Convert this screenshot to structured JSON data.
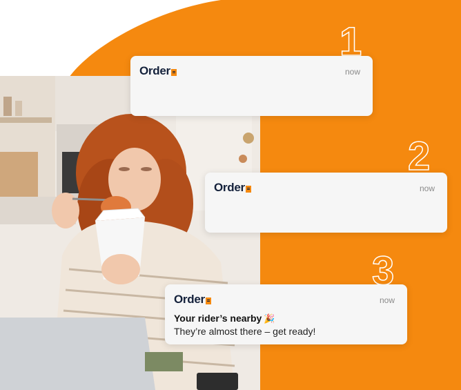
{
  "colors": {
    "accent": "#f5890f",
    "brand_dark": "#14213b",
    "card_bg": "#f6f6f6"
  },
  "steps": [
    "1",
    "2",
    "3"
  ],
  "notifications": [
    {
      "brand": "Order",
      "time": "now",
      "title": "",
      "body": ""
    },
    {
      "brand": "Order",
      "time": "now",
      "title": "",
      "body": ""
    },
    {
      "brand": "Order",
      "time": "now",
      "title": "Your rider’s nearby",
      "body": "They’re almost there – get ready!"
    }
  ],
  "icons": [
    "order-logo-icon",
    "party-popper-icon"
  ]
}
